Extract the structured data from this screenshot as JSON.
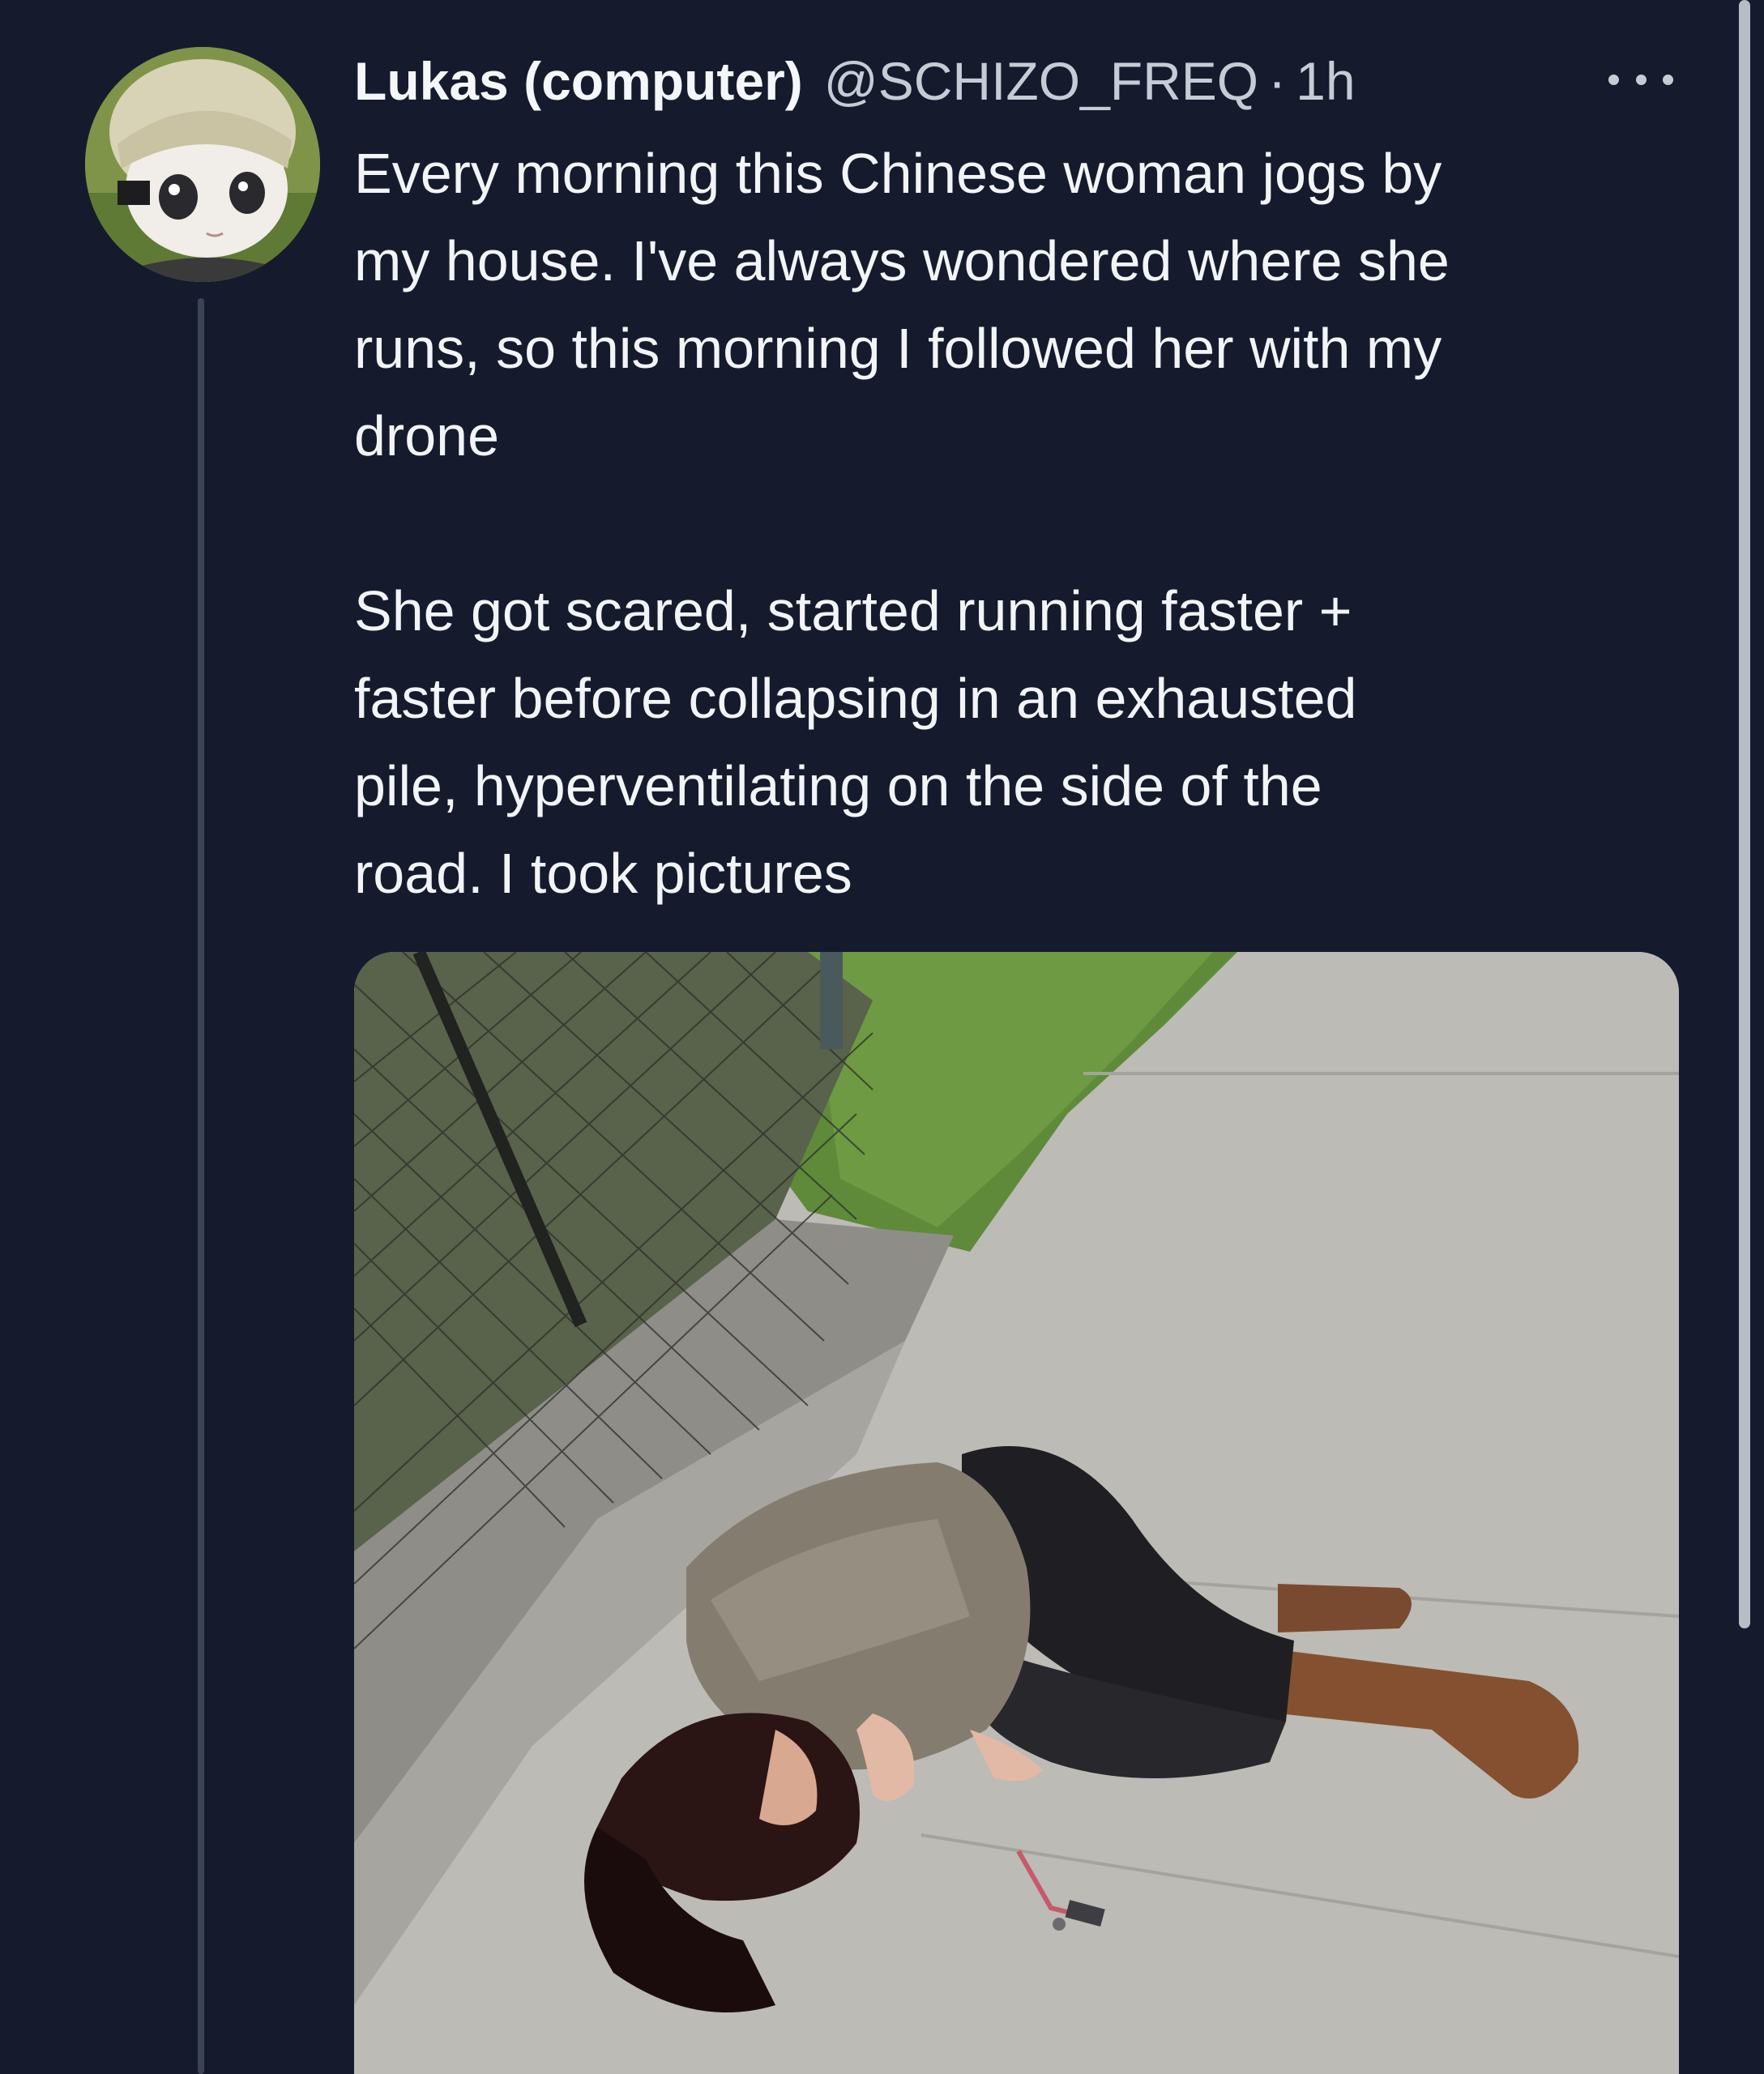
{
  "tweet": {
    "author": {
      "display_name": "Lukas (computer)",
      "handle": "@SCHIZO_FREQ",
      "avatar_icon": "anime-avatar-icon"
    },
    "separator": "·",
    "timestamp": "1h",
    "more_icon": "more-horizontal-icon",
    "text_paragraph_1_lines": [
      "Every morning this Chinese woman jogs by",
      "my house. I've always wondered where she",
      "runs, so this morning I followed her with my",
      "drone"
    ],
    "text_paragraph_2_lines": [
      "She got scared, started running faster +",
      "faster before collapsing in an exhausted",
      "pile, hyperventilating on the side of the",
      "road. I took pictures"
    ]
  },
  "colors": {
    "background": "#151b2d",
    "text_primary": "#f2f4f7",
    "text_secondary": "#c6ccd6",
    "thread_line": "#3b4354"
  }
}
